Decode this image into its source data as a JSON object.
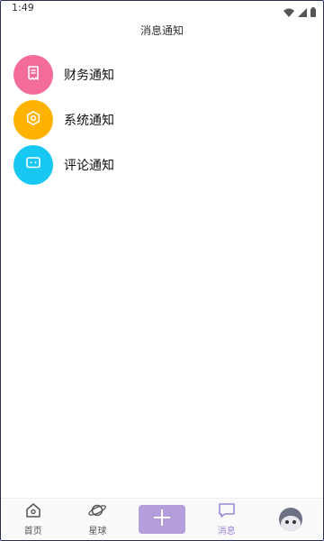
{
  "status_bar": {
    "time": "1:49",
    "icons": [
      "wifi-icon",
      "signal-icon",
      "battery-icon"
    ]
  },
  "header": {
    "title": "消息通知"
  },
  "notifications": [
    {
      "label": "财务通知",
      "icon": "receipt-icon",
      "color": "#f36c9b"
    },
    {
      "label": "系统通知",
      "icon": "hexagon-settings-icon",
      "color": "#ffb300"
    },
    {
      "label": "评论通知",
      "icon": "chat-bubble-icon",
      "color": "#17c8f2"
    }
  ],
  "bottom_nav": {
    "tabs": [
      {
        "label": "首页",
        "icon": "home-icon"
      },
      {
        "label": "星球",
        "icon": "planet-icon"
      },
      {
        "label": "",
        "icon": "plus-icon"
      },
      {
        "label": "消息",
        "icon": "message-icon",
        "active": true
      },
      {
        "label": "",
        "icon": "avatar"
      }
    ],
    "accent_color": "#9b84d8"
  }
}
